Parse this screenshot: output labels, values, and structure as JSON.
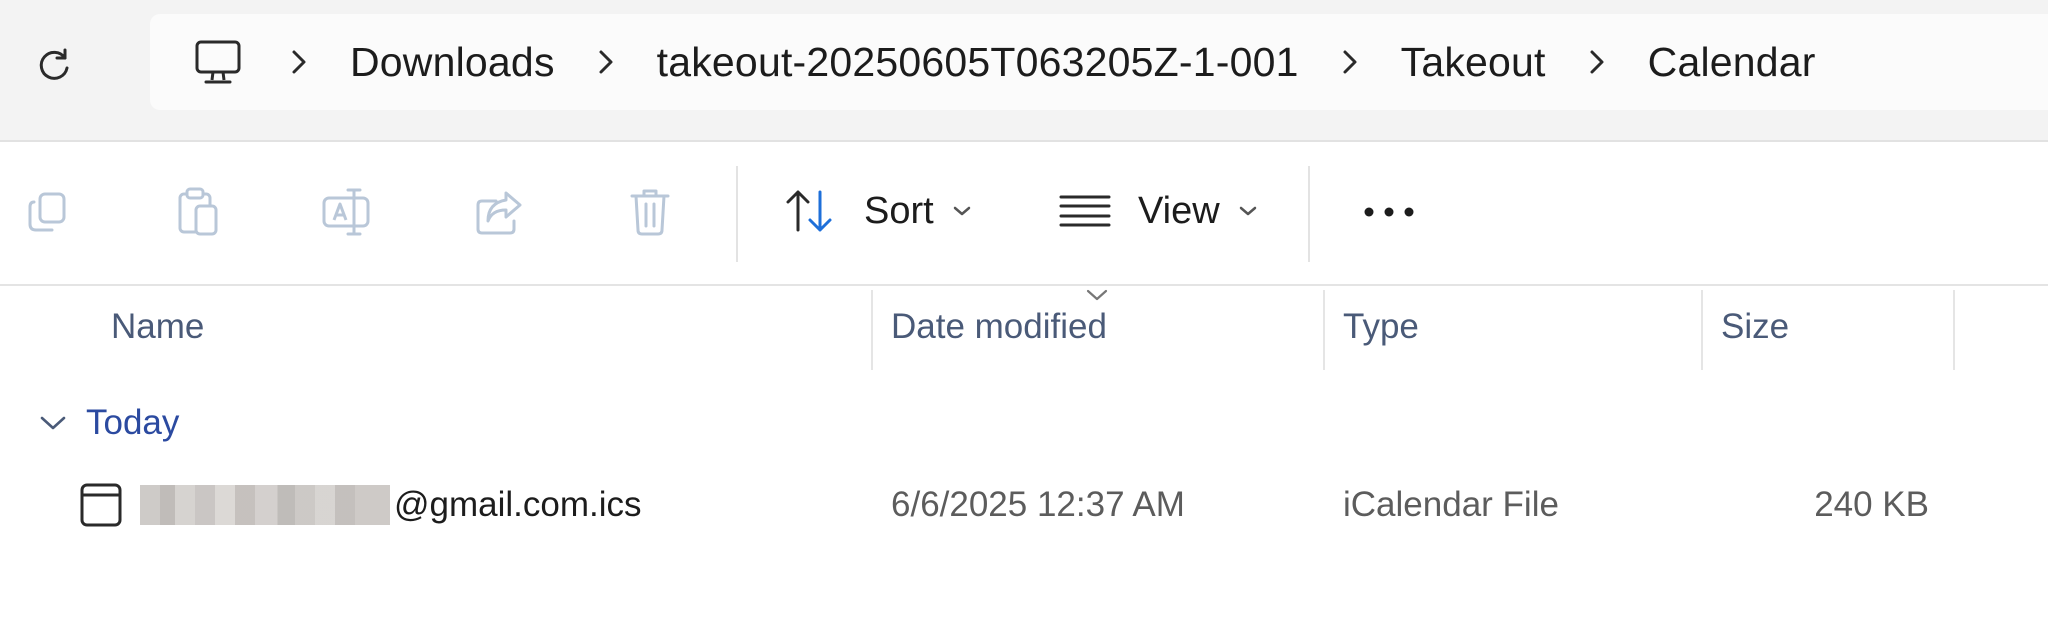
{
  "address_bar": {
    "breadcrumbs": [
      "Downloads",
      "takeout-20250605T063205Z-1-001",
      "Takeout",
      "Calendar"
    ]
  },
  "command_bar": {
    "sort_label": "Sort",
    "view_label": "View",
    "icons": [
      "copy-icon",
      "paste-icon",
      "rename-icon",
      "share-icon",
      "delete-icon",
      "sort-icon",
      "view-icon",
      "more-icon"
    ]
  },
  "columns": {
    "name": "Name",
    "date_modified": "Date modified",
    "type": "Type",
    "size": "Size"
  },
  "groups": [
    {
      "label": "Today",
      "files": [
        {
          "name_suffix": "@gmail.com.ics",
          "date_modified": "6/6/2025 12:37 AM",
          "type": "iCalendar File",
          "size": "240 KB"
        }
      ]
    }
  ],
  "colors": {
    "accent_blue": "#1e6fd9",
    "group_label": "#2b4aa0",
    "header_text": "#4a5a78",
    "disabled_icon": "#b9c7d8"
  }
}
